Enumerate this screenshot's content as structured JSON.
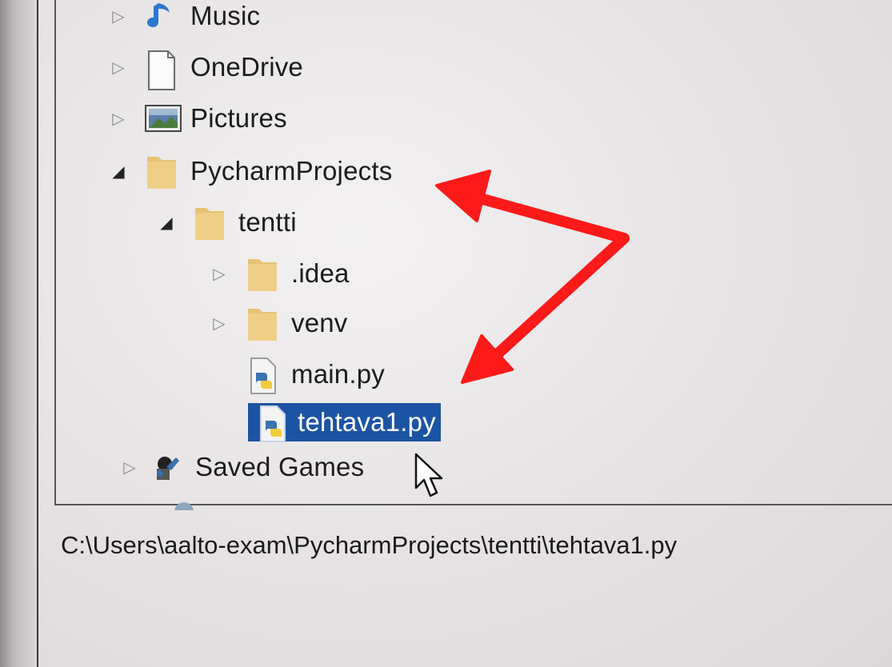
{
  "tree": {
    "items": [
      {
        "label": "Music",
        "expander": "▷",
        "icon": "music-icon"
      },
      {
        "label": "OneDrive",
        "expander": "▷",
        "icon": "document-icon"
      },
      {
        "label": "Pictures",
        "expander": "▷",
        "icon": "pictures-icon"
      },
      {
        "label": "PycharmProjects",
        "expander": "◢",
        "icon": "folder-icon"
      },
      {
        "label": "tentti",
        "expander": "◢",
        "icon": "folder-icon"
      },
      {
        "label": ".idea",
        "expander": "▷",
        "icon": "folder-icon"
      },
      {
        "label": "venv",
        "expander": "▷",
        "icon": "folder-icon"
      },
      {
        "label": "main.py",
        "expander": "",
        "icon": "python-file-icon"
      },
      {
        "label": "tehtava1.py",
        "expander": "",
        "icon": "python-file-icon",
        "selected": true
      },
      {
        "label": "Saved Games",
        "expander": "▷",
        "icon": "saved-games-icon"
      }
    ]
  },
  "status": {
    "path": "C:\\Users\\aalto-exam\\PycharmProjects\\tentti\\tehtava1.py"
  },
  "colors": {
    "selection": "#1c54a4",
    "folder": "#e8c676",
    "annotation_arrow": "#ff1a1a"
  }
}
